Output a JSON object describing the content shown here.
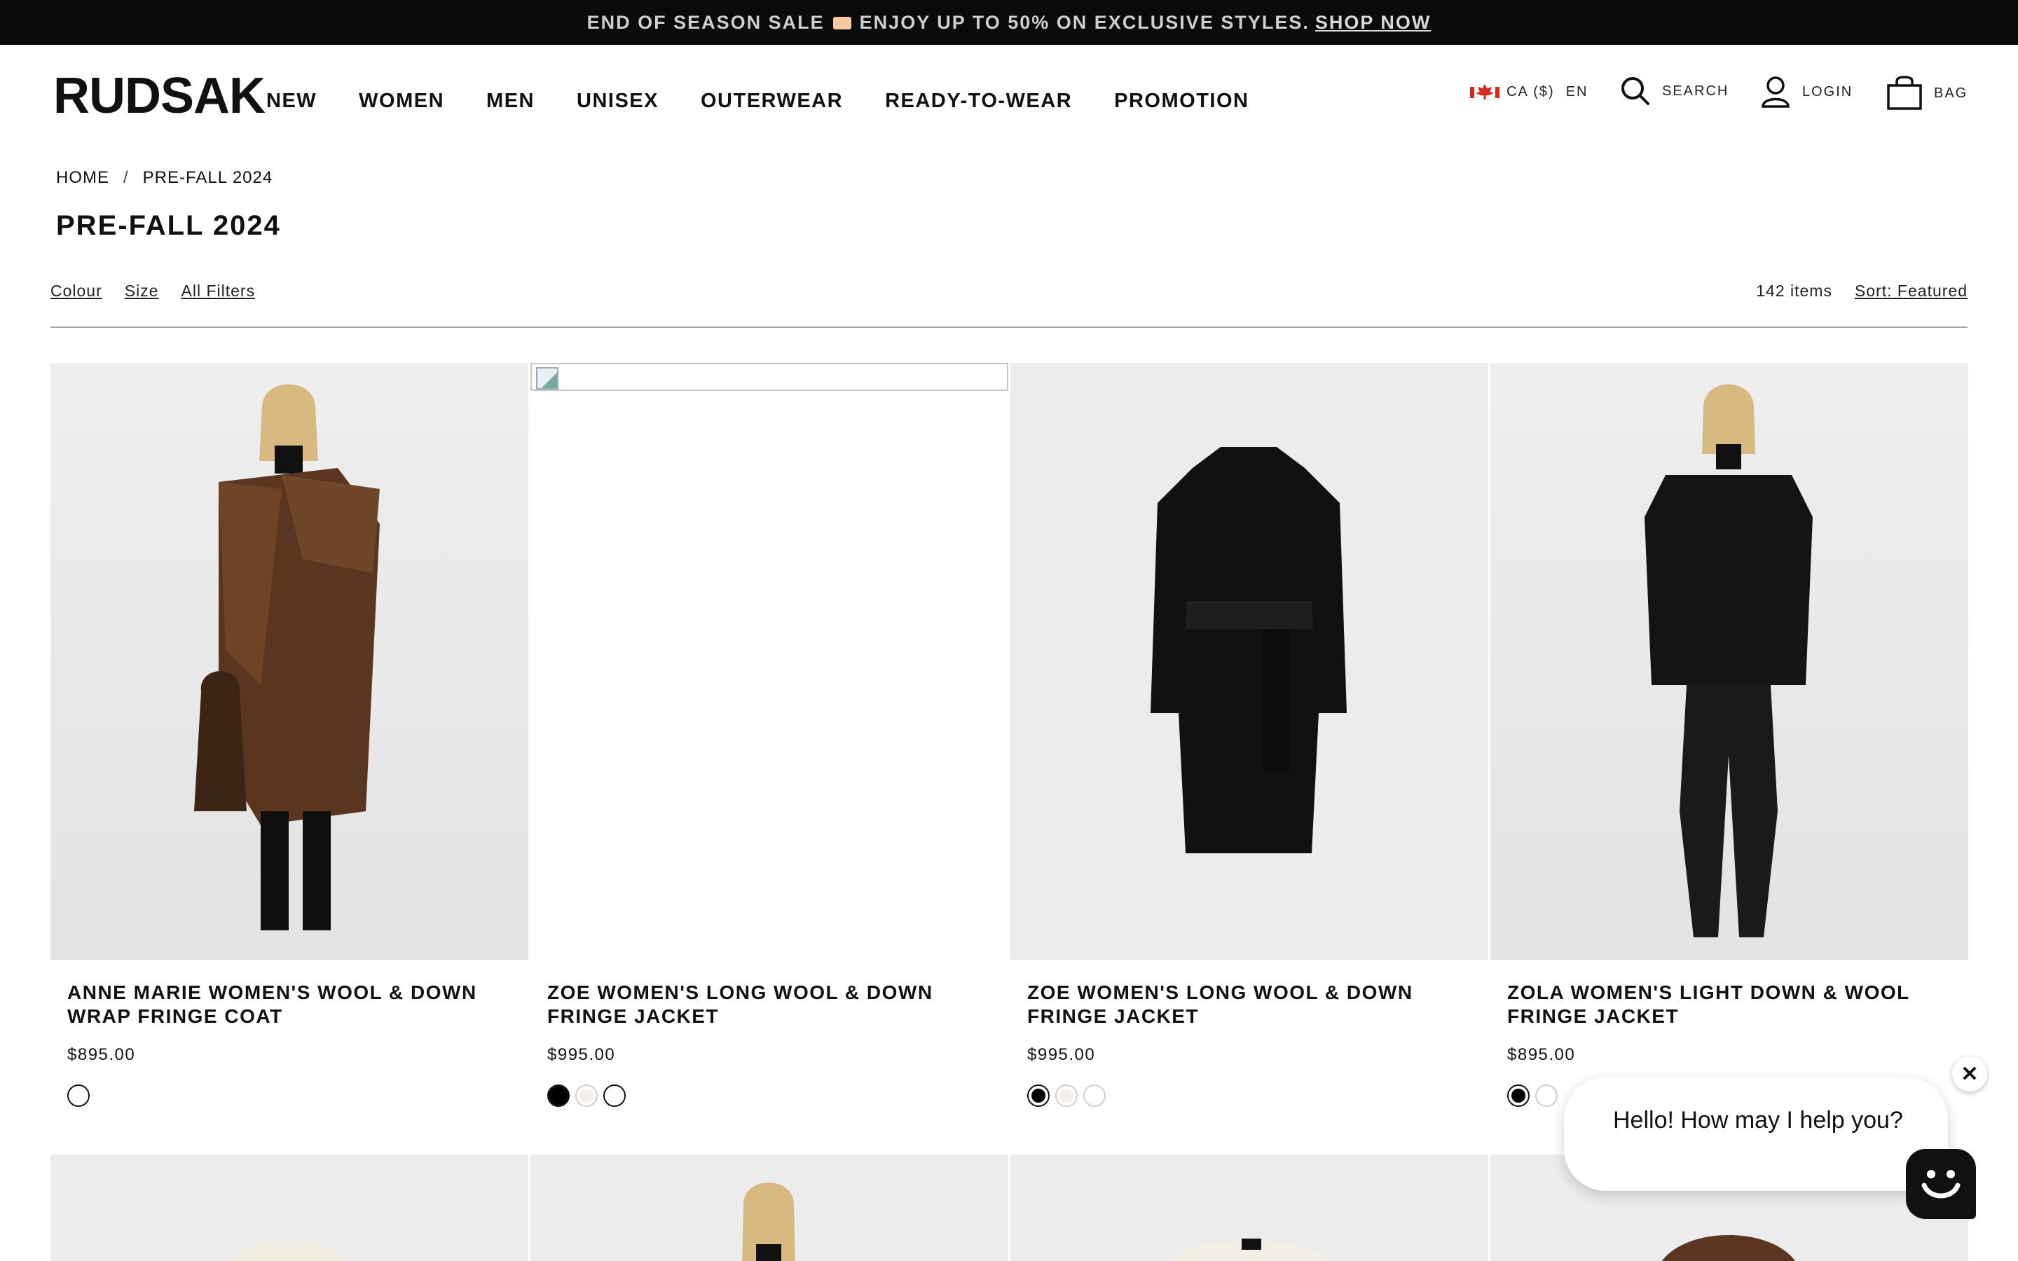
{
  "promo": {
    "text": "END OF SEASON SALE",
    "text2": "ENJOY UP TO 50% ON EXCLUSIVE STYLES.",
    "link": "SHOP NOW"
  },
  "header": {
    "logo": "RUDSAK",
    "nav": [
      "NEW",
      "WOMEN",
      "MEN",
      "UNISEX",
      "OUTERWEAR",
      "READY-TO-WEAR",
      "PROMOTION"
    ],
    "locale": "CA ($)",
    "language": "EN",
    "search_label": "SEARCH",
    "login_label": "LOGIN",
    "bag_label": "BAG"
  },
  "breadcrumb": {
    "home": "HOME",
    "current": "PRE-FALL 2024"
  },
  "page_title": "PRE-FALL 2024",
  "filters": {
    "colour": "Colour",
    "size": "Size",
    "all": "All Filters"
  },
  "results": {
    "count": "142 items",
    "sort": "Sort: Featured"
  },
  "products": [
    {
      "name": "ANNE MARIE WOMEN'S WOOL & DOWN WRAP FRINGE COAT",
      "price": "$895.00",
      "swatches": [
        "#5a3620"
      ]
    },
    {
      "name": "ZOE WOMEN'S LONG WOOL & DOWN FRINGE JACKET",
      "price": "$995.00",
      "swatches": [
        "#000000",
        "#f1e7e3",
        "#ffffff"
      ]
    },
    {
      "name": "ZOE WOMEN'S LONG WOOL & DOWN FRINGE JACKET",
      "price": "$995.00",
      "swatches": [
        "#000000",
        "#f1e7e3",
        "#ffffff"
      ]
    },
    {
      "name": "ZOLA WOMEN'S LIGHT DOWN & WOOL FRINGE JACKET",
      "price": "$895.00",
      "swatches": [
        "#000000",
        "#ffffff"
      ]
    }
  ],
  "chat": {
    "message": "Hello! How may I help you?"
  }
}
